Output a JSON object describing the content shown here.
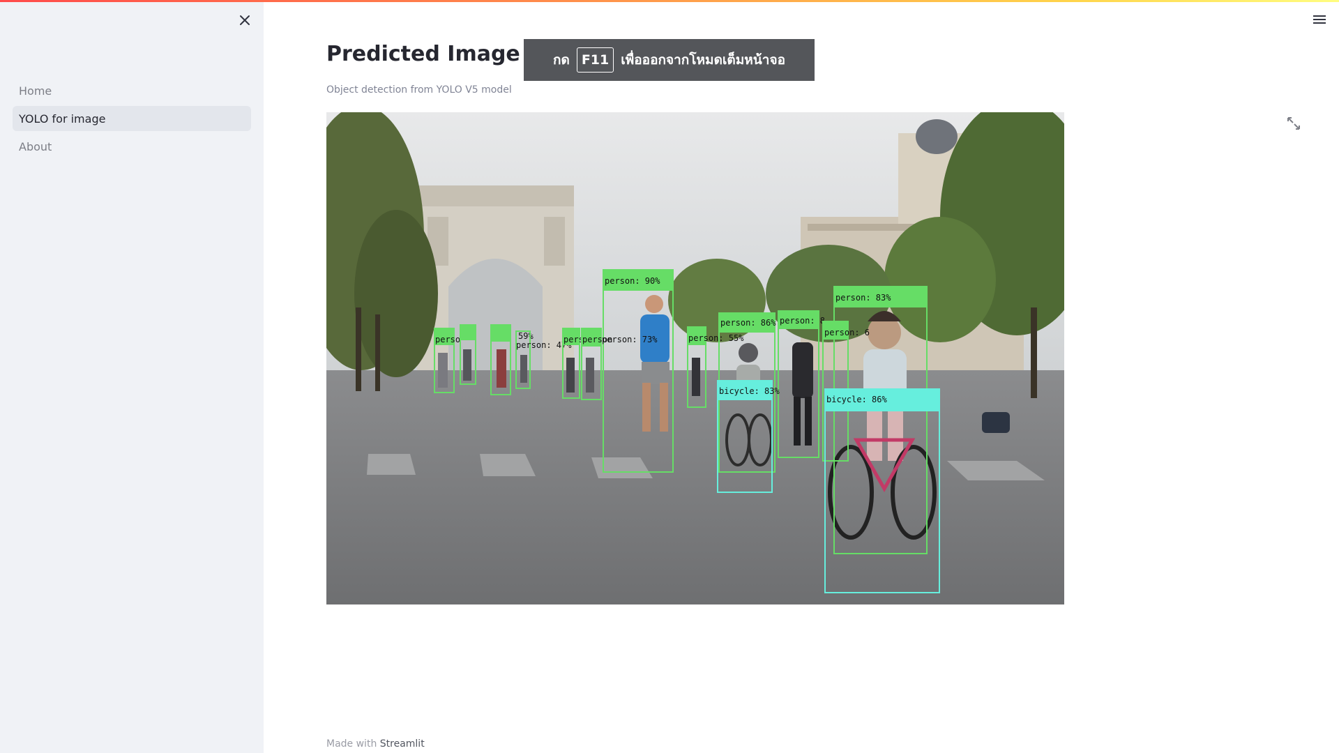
{
  "sidebar": {
    "close_icon": "close-icon",
    "items": [
      {
        "label": "Home",
        "active": false
      },
      {
        "label": "YOLO for image",
        "active": true
      },
      {
        "label": "About",
        "active": false
      }
    ]
  },
  "header": {
    "menu_icon": "hamburger-menu-icon"
  },
  "main": {
    "title": "Predicted Image",
    "caption": "Object detection from YOLO V5 model",
    "fullscreen_icon": "expand-icon"
  },
  "overlay": {
    "prefix": "กด",
    "key": "F11",
    "suffix": "เพื่อออกจากโหมดเต็มหน้าจอ"
  },
  "image": {
    "detections": [
      "person: 90%",
      "person: 83%",
      "person: 86%",
      "person: 8",
      "person: 6",
      "bicycle: 83%",
      "bicycle: 86%",
      "person: 47%",
      "person: 73%",
      "person: 55%",
      "59%",
      "perso",
      "person",
      "pers"
    ]
  },
  "footer": {
    "made_with": "Made with",
    "brand": "Streamlit"
  },
  "colors": {
    "person_box": "#66dd66",
    "bicycle_box": "#66eedd",
    "sidebar_bg": "#f0f2f6",
    "accent_gradient": [
      "#ff4b4b",
      "#ffd44b"
    ]
  }
}
